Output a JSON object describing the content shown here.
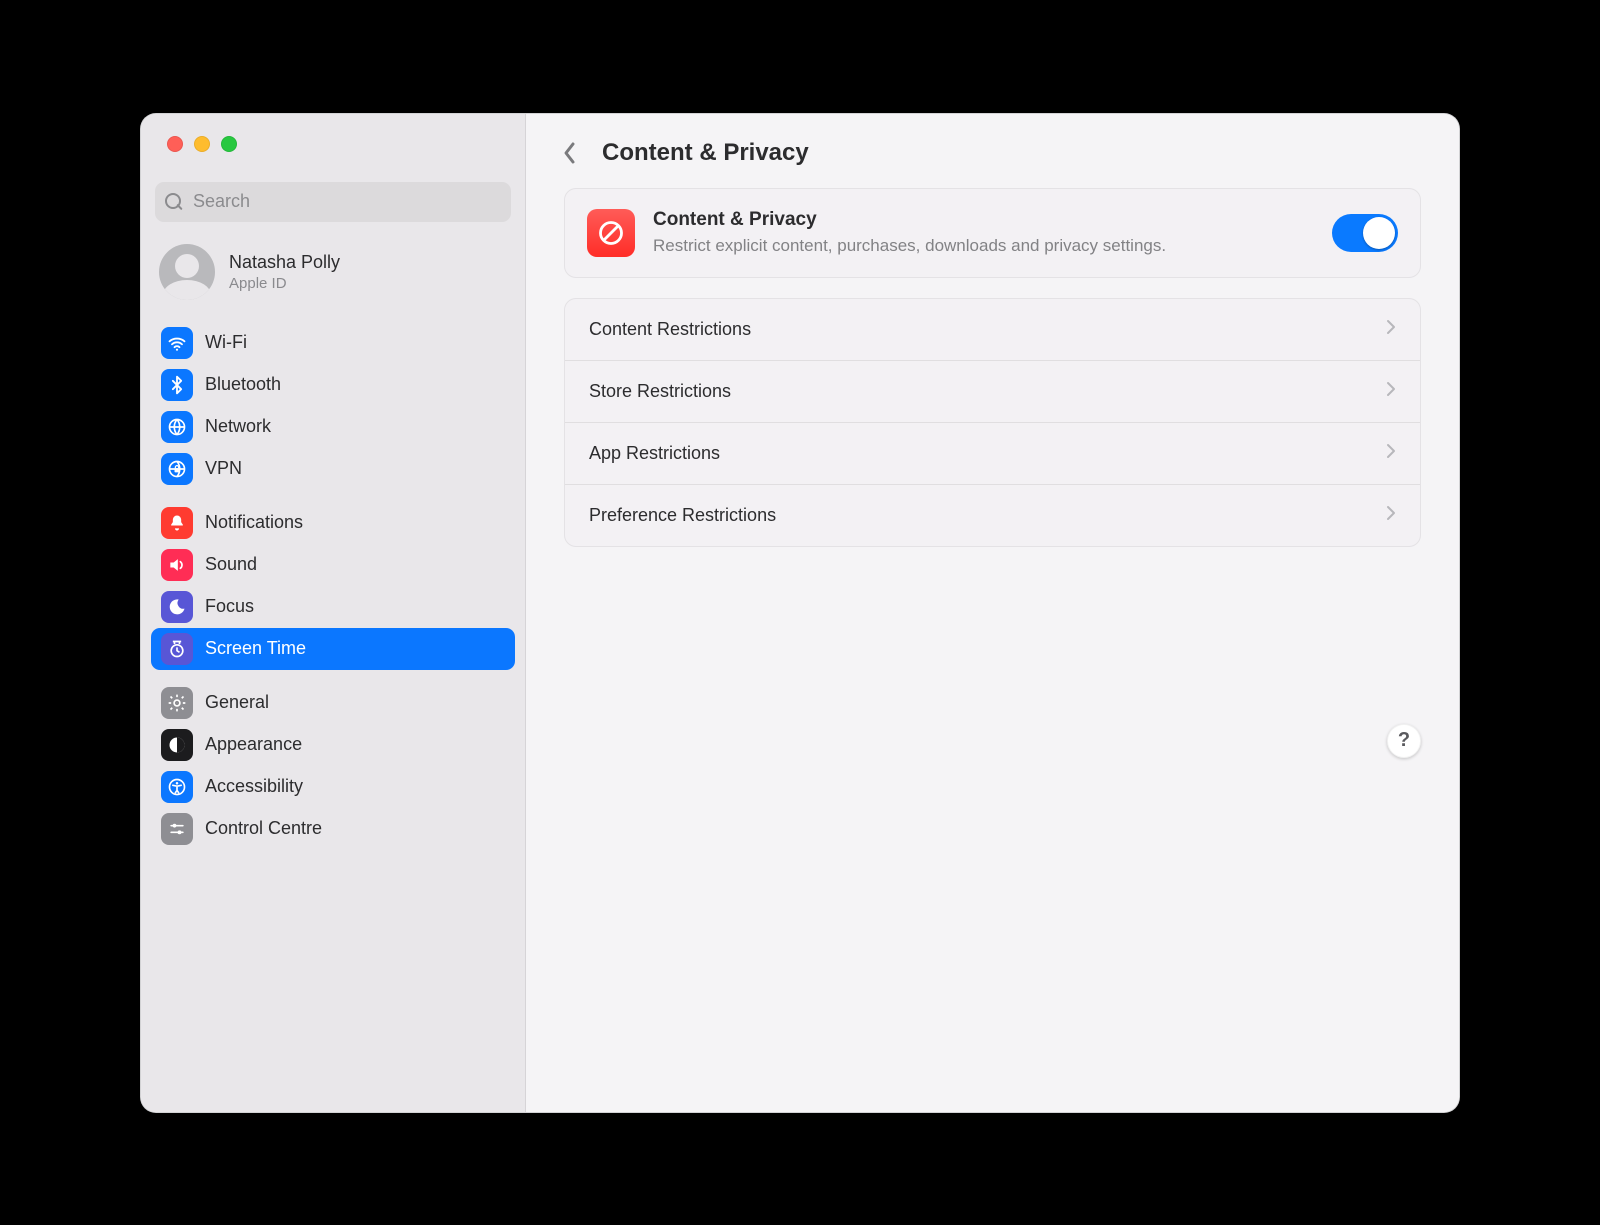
{
  "search": {
    "placeholder": "Search"
  },
  "account": {
    "name": "Natasha Polly",
    "subtitle": "Apple ID"
  },
  "sidebar": {
    "groups": [
      {
        "items": [
          {
            "label": "Wi-Fi"
          },
          {
            "label": "Bluetooth"
          },
          {
            "label": "Network"
          },
          {
            "label": "VPN"
          }
        ]
      },
      {
        "items": [
          {
            "label": "Notifications"
          },
          {
            "label": "Sound"
          },
          {
            "label": "Focus"
          },
          {
            "label": "Screen Time"
          }
        ]
      },
      {
        "items": [
          {
            "label": "General"
          },
          {
            "label": "Appearance"
          },
          {
            "label": "Accessibility"
          },
          {
            "label": "Control Centre"
          }
        ]
      }
    ]
  },
  "header": {
    "title": "Content & Privacy"
  },
  "hero": {
    "title": "Content & Privacy",
    "desc": "Restrict explicit content, purchases, downloads and privacy settings.",
    "enabled": true
  },
  "rows": [
    {
      "label": "Content Restrictions"
    },
    {
      "label": "Store Restrictions"
    },
    {
      "label": "App Restrictions"
    },
    {
      "label": "Preference Restrictions"
    }
  ],
  "help": {
    "label": "?"
  }
}
